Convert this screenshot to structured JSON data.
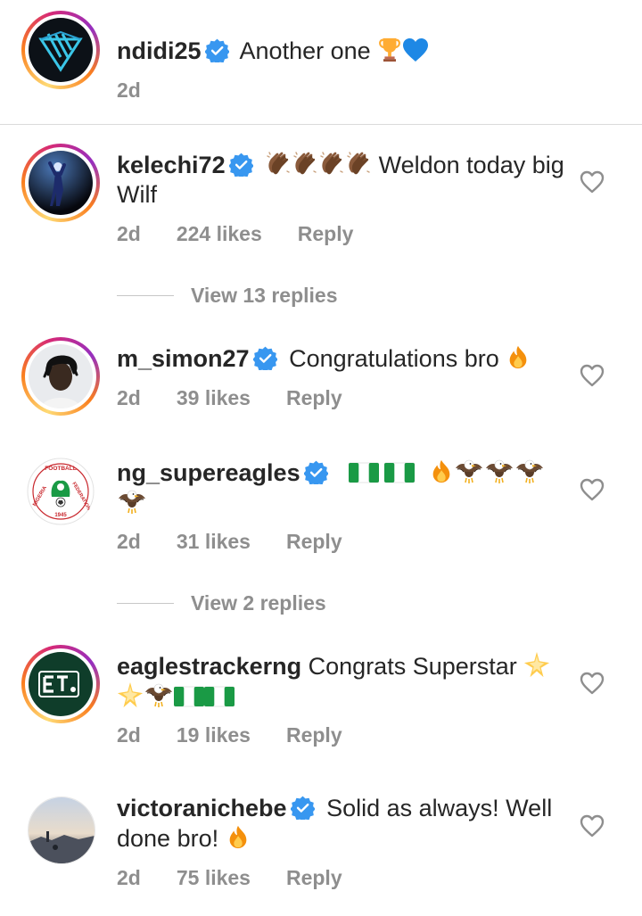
{
  "caption": {
    "username": "ndidi25",
    "text": "Another one",
    "emoji": [
      "trophy",
      "blue-heart"
    ],
    "time": "2d"
  },
  "comments": [
    {
      "username": "kelechi72",
      "text": "Weldon today big Wilf",
      "emoji": [
        "clapping-hands",
        "clapping-hands",
        "clapping-hands",
        "clapping-hands"
      ],
      "time": "2d",
      "likes": "224 likes",
      "reply": "Reply",
      "view_replies": "View 13 replies"
    },
    {
      "username": "m_simon27",
      "text": "Congratulations bro",
      "emoji": [
        "fire"
      ],
      "time": "2d",
      "likes": "39 likes",
      "reply": "Reply"
    },
    {
      "username": "ng_supereagles",
      "text": "",
      "emoji": [
        "nigeria-flag",
        "nigeria-flag",
        "fire",
        "eagle",
        "eagle",
        "eagle",
        "eagle"
      ],
      "time": "2d",
      "likes": "31 likes",
      "reply": "Reply",
      "view_replies": "View 2 replies",
      "avatar_text": "NIGERIA FOOTBALL FEDERATION 1945"
    },
    {
      "username": "eaglestrackerng",
      "text": "Congrats Superstar",
      "emoji": [
        "glowing-star",
        "glowing-star",
        "eagle",
        "nigeria-flag"
      ],
      "time": "2d",
      "likes": "19 likes",
      "reply": "Reply",
      "avatar_text": "ET"
    },
    {
      "username": "victoranichebe",
      "text_part1": "Solid as always! Well",
      "text_part2": "done bro!",
      "emoji": [
        "fire"
      ],
      "time": "2d",
      "likes": "75 likes",
      "reply": "Reply"
    }
  ],
  "colors": {
    "text": "#262626",
    "meta": "#8e8e8e",
    "verified": "#3897f0",
    "divider": "#dbdbdb"
  }
}
